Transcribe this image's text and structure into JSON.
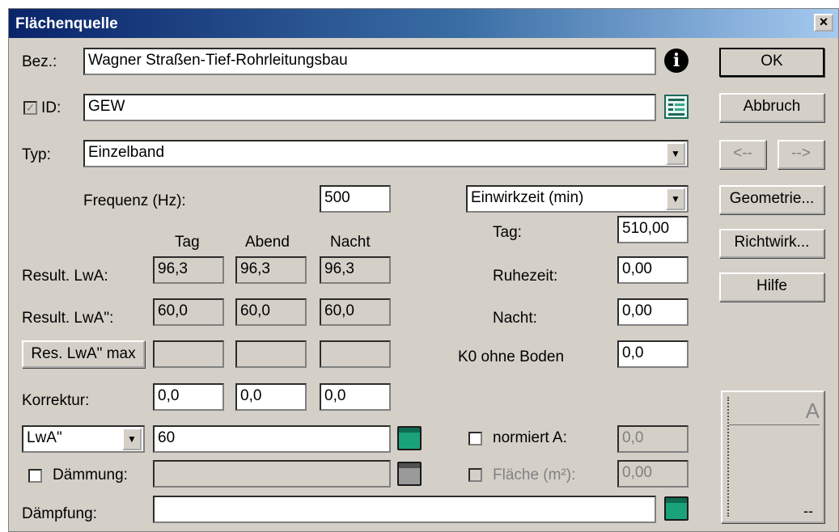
{
  "window": {
    "title": "Flächenquelle",
    "close_label": "×"
  },
  "bez": {
    "label": "Bez.:",
    "value": "Wagner Straßen-Tief-Rohrleitungsbau"
  },
  "id": {
    "label": "ID:",
    "value": "GEW",
    "checked": true
  },
  "typ": {
    "label": "Typ:",
    "value": "Einzelband"
  },
  "frequenz": {
    "label": "Frequenz (Hz):",
    "value": "500"
  },
  "einwirkzeit": {
    "value": "Einwirkzeit (min)"
  },
  "columns": {
    "tag": "Tag",
    "abend": "Abend",
    "nacht": "Nacht"
  },
  "result_lwa": {
    "label": "Result. LwA:",
    "values": [
      "96,3",
      "96,3",
      "96,3"
    ]
  },
  "result_lwa2": {
    "label": "Result. LwA\":",
    "values": [
      "60,0",
      "60,0",
      "60,0"
    ]
  },
  "res_max": {
    "label": "Res. LwA\" max"
  },
  "korrektur": {
    "label": "Korrektur:",
    "values": [
      "0,0",
      "0,0",
      "0,0"
    ]
  },
  "lwa_select": {
    "value": "LwA\"",
    "input": "60"
  },
  "daemmung": {
    "label": "Dämmung:",
    "checked": false
  },
  "daempfung": {
    "label": "Dämpfung:",
    "value": ""
  },
  "times": {
    "tag": {
      "label": "Tag:",
      "value": "510,00"
    },
    "ruhezeit": {
      "label": "Ruhezeit:",
      "value": "0,00"
    },
    "nacht": {
      "label": "Nacht:",
      "value": "0,00"
    }
  },
  "k0": {
    "label": "K0 ohne Boden",
    "value": "0,0"
  },
  "normiert": {
    "label": "normiert A:",
    "value": "0,0",
    "checked": false
  },
  "flaeche": {
    "label": "Fläche (m²):",
    "value": "0,00",
    "checked": false
  },
  "buttons": {
    "ok": "OK",
    "abbruch": "Abbruch",
    "prev": "<--",
    "next": "-->",
    "geometrie": "Geometrie...",
    "richtwirk": "Richtwirk...",
    "hilfe": "Hilfe"
  },
  "preview": {
    "letter": "A",
    "dash": "--"
  }
}
